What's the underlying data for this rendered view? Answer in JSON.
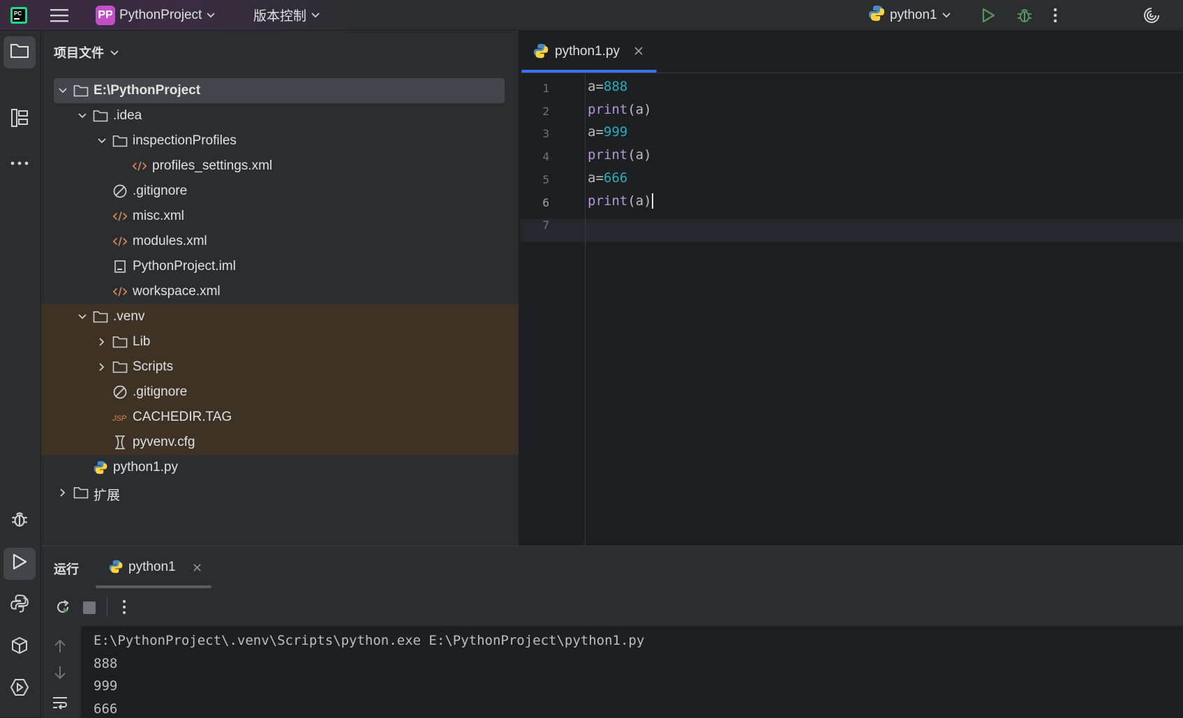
{
  "titlebar": {
    "project_badge": "PP",
    "project_name": "PythonProject",
    "vcs_label": "版本控制",
    "run_config": "python1"
  },
  "project_panel": {
    "title": "项目文件",
    "tree": [
      {
        "label": "E:\\PythonProject",
        "type": "folder",
        "expanded": true
      },
      {
        "label": ".idea",
        "type": "folder",
        "expanded": true
      },
      {
        "label": "inspectionProfiles",
        "type": "folder",
        "expanded": true
      },
      {
        "label": "profiles_settings.xml",
        "type": "xml"
      },
      {
        "label": ".gitignore",
        "type": "ignore"
      },
      {
        "label": "misc.xml",
        "type": "xml"
      },
      {
        "label": "modules.xml",
        "type": "xml"
      },
      {
        "label": "PythonProject.iml",
        "type": "iml"
      },
      {
        "label": "workspace.xml",
        "type": "xml"
      },
      {
        "label": ".venv",
        "type": "folder",
        "expanded": true
      },
      {
        "label": "Lib",
        "type": "folder",
        "expanded": false
      },
      {
        "label": "Scripts",
        "type": "folder",
        "expanded": false
      },
      {
        "label": ".gitignore",
        "type": "ignore"
      },
      {
        "label": "CACHEDIR.TAG",
        "type": "tag"
      },
      {
        "label": "pyvenv.cfg",
        "type": "cfg"
      },
      {
        "label": "python1.py",
        "type": "python"
      },
      {
        "label": "扩展",
        "type": "folder",
        "expanded": false
      }
    ]
  },
  "editor": {
    "tab_label": "python1.py",
    "line_numbers": [
      "1",
      "2",
      "3",
      "4",
      "5",
      "6",
      "7"
    ],
    "lines": [
      {
        "a": "a=",
        "b": "888"
      },
      {
        "a": "print",
        "b": "(a)"
      },
      {
        "a": "a=",
        "b": "999"
      },
      {
        "a": "print",
        "b": "(a)"
      },
      {
        "a": "a=",
        "b": "666"
      },
      {
        "a": "print",
        "b": "(a)"
      }
    ],
    "current_line": 6
  },
  "run_panel": {
    "title": "运行",
    "tab_label": "python1",
    "output": [
      "E:\\PythonProject\\.venv\\Scripts\\python.exe E:\\PythonProject\\python1.py",
      "888",
      "999",
      "666"
    ]
  },
  "colors": {
    "accent": "#3574f0",
    "keyword": "#b39ad6",
    "number": "#2aacb8",
    "excluded_bg": "#3d3223"
  }
}
